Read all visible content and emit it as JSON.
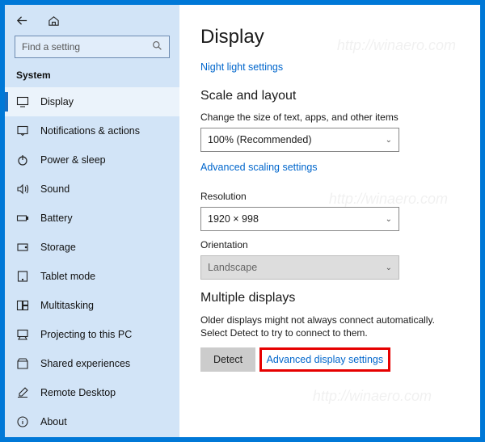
{
  "watermark": "http://winaero.com",
  "sidebar": {
    "search_placeholder": "Find a setting",
    "section_label": "System",
    "items": [
      {
        "label": "Display",
        "selected": true
      },
      {
        "label": "Notifications & actions"
      },
      {
        "label": "Power & sleep"
      },
      {
        "label": "Sound"
      },
      {
        "label": "Battery"
      },
      {
        "label": "Storage"
      },
      {
        "label": "Tablet mode"
      },
      {
        "label": "Multitasking"
      },
      {
        "label": "Projecting to this PC"
      },
      {
        "label": "Shared experiences"
      },
      {
        "label": "Remote Desktop"
      },
      {
        "label": "About"
      }
    ]
  },
  "main": {
    "title": "Display",
    "night_light_link": "Night light settings",
    "scale_section": "Scale and layout",
    "scale_label": "Change the size of text, apps, and other items",
    "scale_value": "100% (Recommended)",
    "advanced_scaling_link": "Advanced scaling settings",
    "resolution_label": "Resolution",
    "resolution_value": "1920 × 998",
    "orientation_label": "Orientation",
    "orientation_value": "Landscape",
    "multiple_section": "Multiple displays",
    "multiple_desc": "Older displays might not always connect automatically. Select Detect to try to connect to them.",
    "detect_button": "Detect",
    "advanced_display_link": "Advanced display settings"
  }
}
